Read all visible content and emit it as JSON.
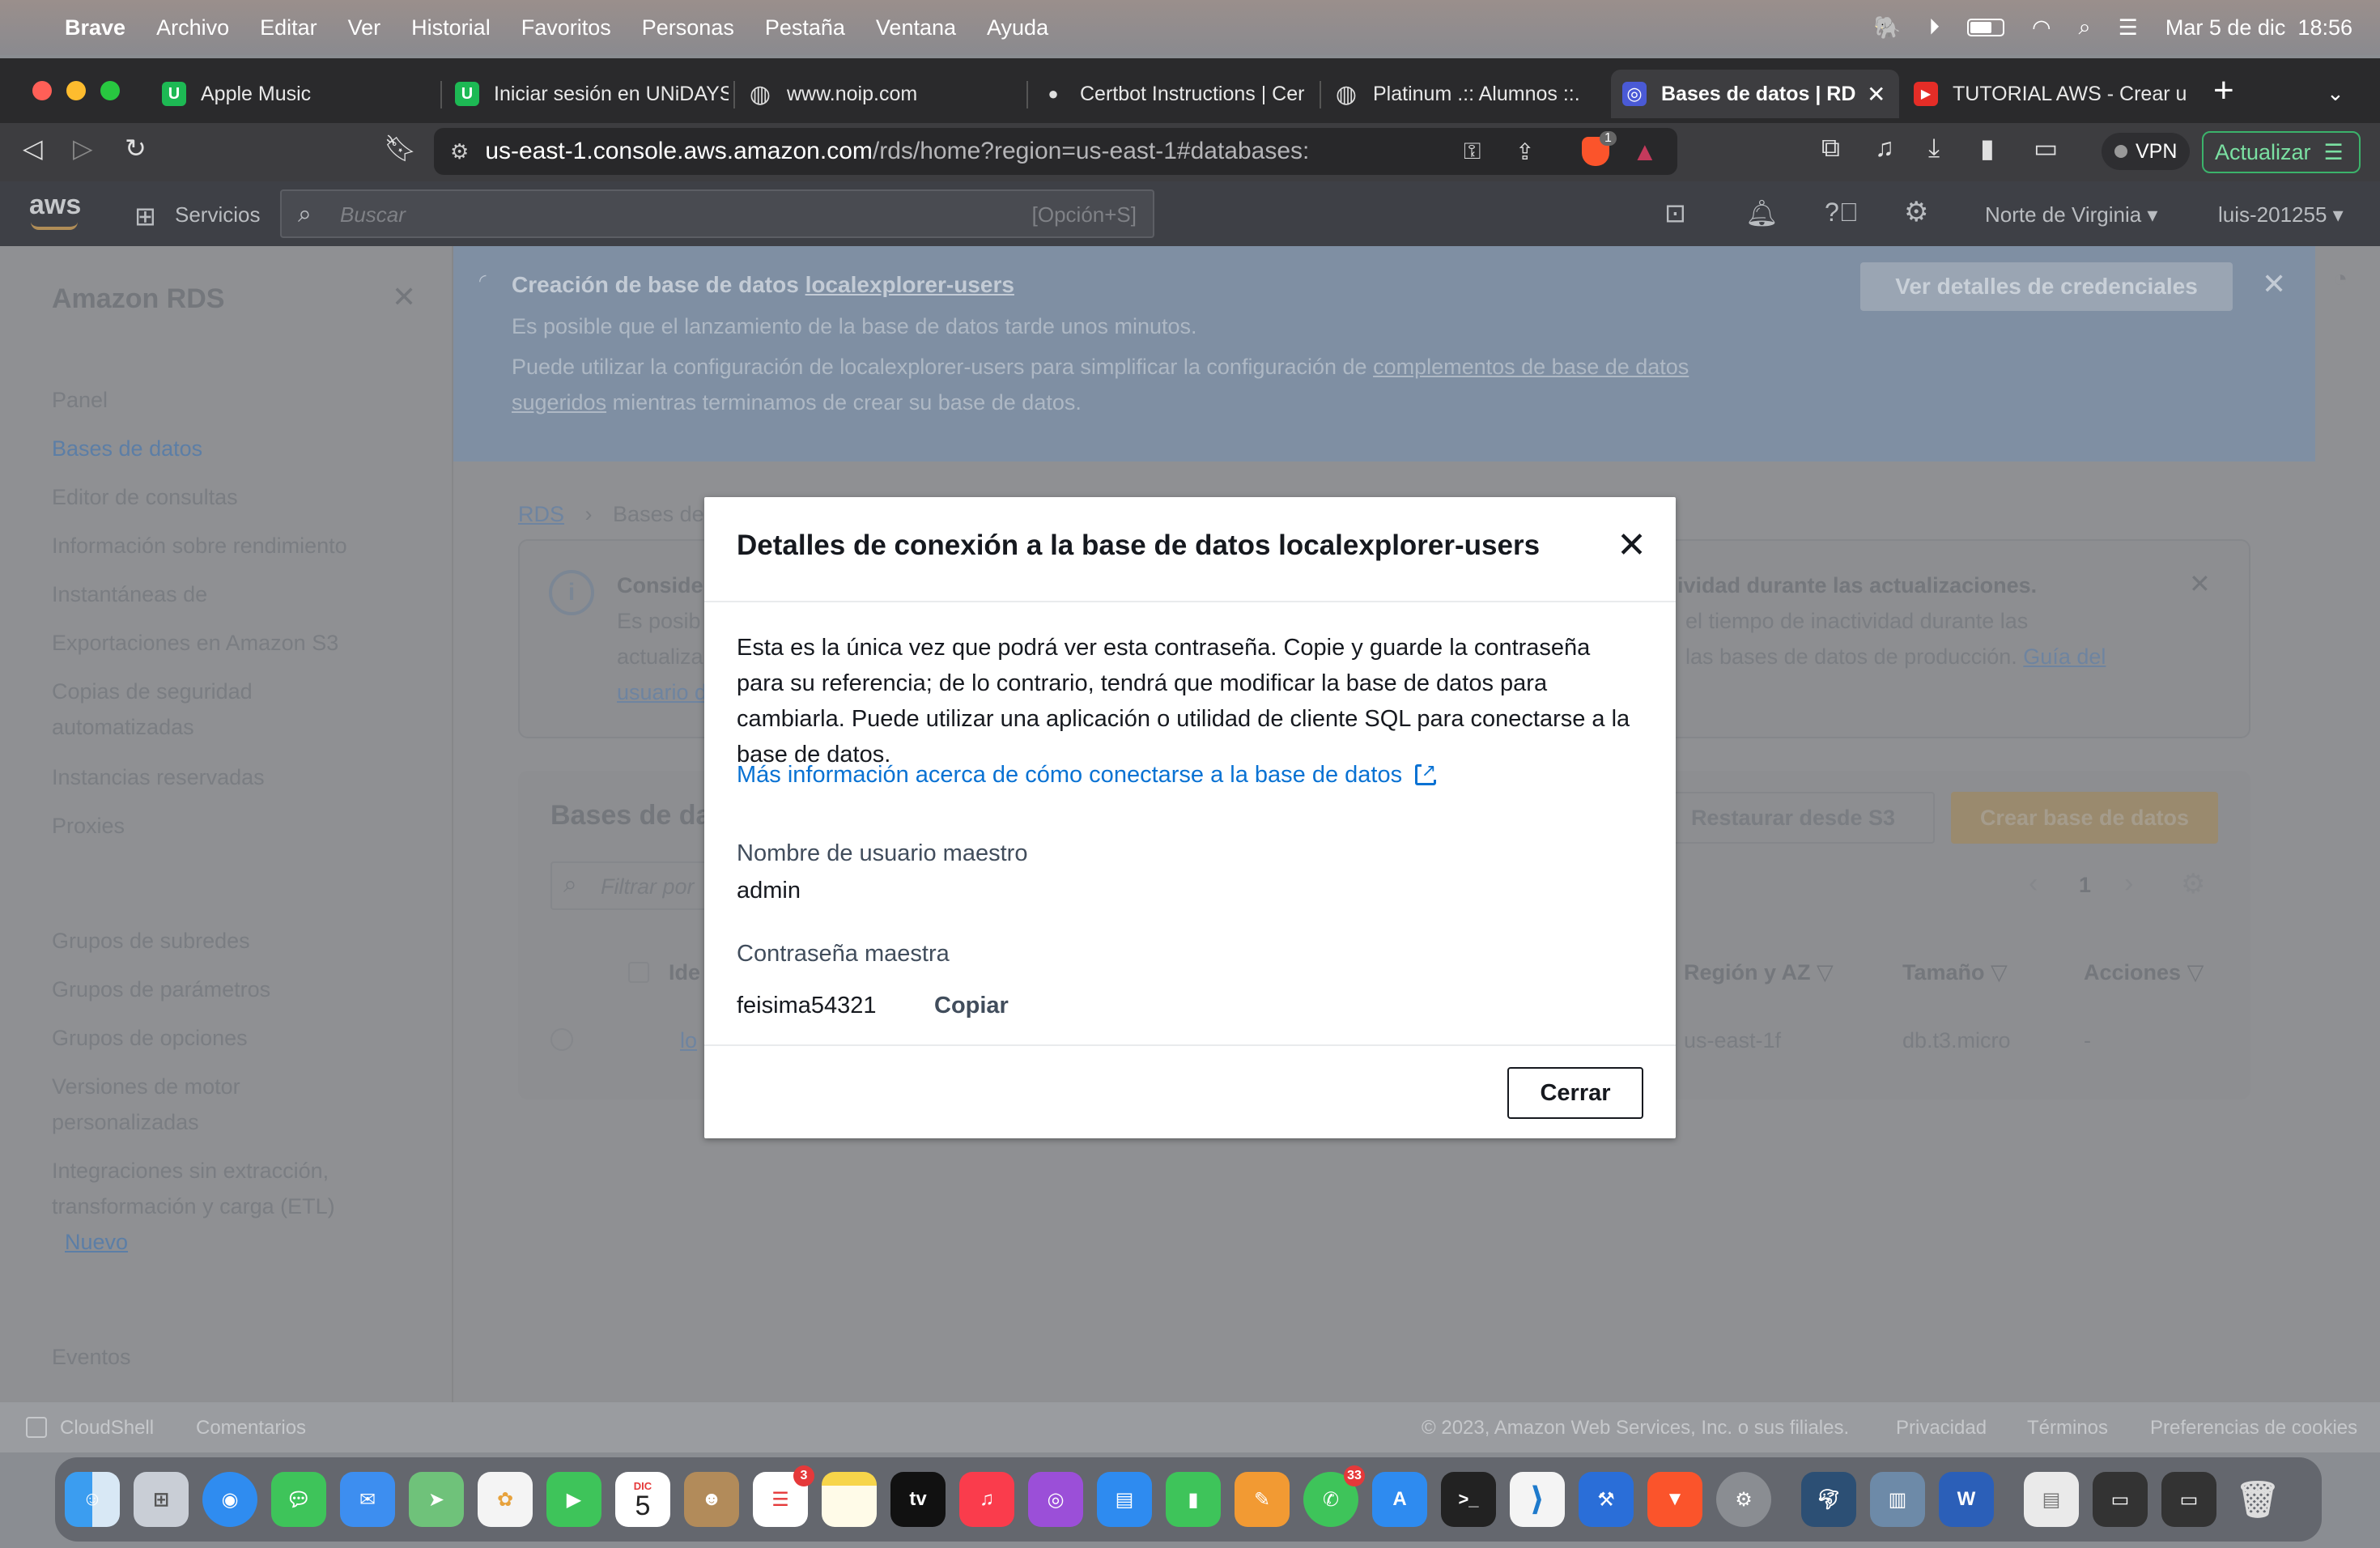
{
  "menubar": {
    "app": "Brave",
    "items": [
      "Archivo",
      "Editar",
      "Ver",
      "Historial",
      "Favoritos",
      "Personas",
      "Pestaña",
      "Ventana",
      "Ayuda"
    ],
    "datetime": "Mar 5 de dic  18:56"
  },
  "tabs": [
    {
      "label": "Apple Music",
      "icon": "unidays-icon",
      "color": "#1db954",
      "glyph": "U"
    },
    {
      "label": "Iniciar sesión en UNiDAYS",
      "icon": "unidays-icon",
      "color": "#1db954",
      "glyph": "U"
    },
    {
      "label": "www.noip.com",
      "icon": "globe-icon",
      "color": "#5a5a5e",
      "glyph": "◍"
    },
    {
      "label": "Certbot Instructions | Cer",
      "icon": "certbot-icon",
      "color": "#2a2a2c",
      "glyph": "●"
    },
    {
      "label": "Platinum .:: Alumnos ::.",
      "icon": "globe-icon",
      "color": "#5a5a5e",
      "glyph": "◍"
    },
    {
      "label": "Bases de datos | RDS",
      "icon": "rds-icon",
      "color": "#4a5ad6",
      "glyph": "◎",
      "active": true
    },
    {
      "label": "TUTORIAL AWS - Crear u",
      "icon": "youtube-icon",
      "color": "#e52d27",
      "glyph": "▶"
    }
  ],
  "address": {
    "host": "us-east-1.console.aws.amazon.com",
    "path": "/rds/home?region=us-east-1#databases:"
  },
  "browser": {
    "vpn_label": "VPN",
    "update_label": "Actualizar",
    "shield_count": "1"
  },
  "aws": {
    "logo": "aws",
    "services_label": "Servicios",
    "search_placeholder": "Buscar",
    "search_shortcut": "[Opción+S]",
    "region": "Norte de Virginia",
    "account": "luis-201255"
  },
  "sidebar": {
    "title": "Amazon RDS",
    "items": [
      "Panel",
      "Bases de datos",
      "Editor de consultas",
      "Información sobre rendimiento",
      "Instantáneas de",
      "Exportaciones en Amazon S3",
      "Copias de seguridad",
      "automatizadas",
      "Instancias reservadas",
      "Proxies",
      "Grupos de subredes",
      "Grupos de parámetros",
      "Grupos de opciones",
      "Versiones de motor",
      "personalizadas",
      "Integraciones sin extracción,",
      "transformación y carga (ETL)",
      "Nuevo",
      "Eventos"
    ]
  },
  "banner": {
    "title_prefix": "Creación de base de datos ",
    "title_link": "localexplorer-users",
    "line1": "Es posible que el lanzamiento de la base de datos tarde unos minutos.",
    "line2_prefix": "Puede utilizar la configuración de localexplorer-users para simplificar la configuración de ",
    "line2_link": "complementos de base de datos",
    "line3_link": "sugeridos",
    "line3_suffix": " mientras terminamos de crear su base de datos.",
    "button": "Ver detalles de credenciales"
  },
  "background": {
    "breadcrumb_rds": "RDS",
    "breadcrumb_current": "Bases de",
    "info_title_left": "Consider",
    "info_title_right": "ividad durante las actualizaciones.",
    "info_l1_left": "Es posib",
    "info_l1_right": "el tiempo de inactividad durante las",
    "info_l2_left": "actualiza",
    "info_l2_right": "las bases de datos de producción.",
    "info_l2_link": "Guía del",
    "info_l3_link": "usuario d",
    "panel_title": "Bases de da",
    "btn_restore": "Restaurar desde S3",
    "btn_create": "Crear base de datos",
    "filter_placeholder": "Filtrar por",
    "page_num": "1",
    "col_id": "Ide",
    "col_region": "Región y AZ",
    "col_size": "Tamaño",
    "col_actions": "Acciones",
    "row_id": "lo",
    "row_region": "us-east-1f",
    "row_size": "db.t3.micro",
    "row_actions": "-"
  },
  "modal": {
    "title": "Detalles de conexión a la base de datos localexplorer-users",
    "body": "Esta es la única vez que podrá ver esta contraseña. Copie y guarde la contraseña para su referencia; de lo contrario, tendrá que modificar la base de datos para cambiarla. Puede utilizar una aplicación o utilidad de cliente SQL para conectarse a la base de datos.",
    "link": "Más información acerca de cómo conectarse a la base de datos",
    "username_label": "Nombre de usuario maestro",
    "username_value": "admin",
    "password_label": "Contraseña maestra",
    "password_value": "feisima54321",
    "copy_label": "Copiar",
    "close_button": "Cerrar"
  },
  "footer": {
    "cloudshell": "CloudShell",
    "comments": "Comentarios",
    "copyright": "© 2023, Amazon Web Services, Inc. o sus filiales.",
    "privacy": "Privacidad",
    "terms": "Términos",
    "cookies": "Preferencias de cookies"
  },
  "dock": {
    "calendar_month": "DIC",
    "calendar_day": "5",
    "reminders_badge": "3",
    "whatsapp_badge": "33",
    "tv_label": "tv"
  },
  "colors": {
    "link": "#0972d3",
    "aws_orange": "#ff9900",
    "text": "#16191f"
  }
}
